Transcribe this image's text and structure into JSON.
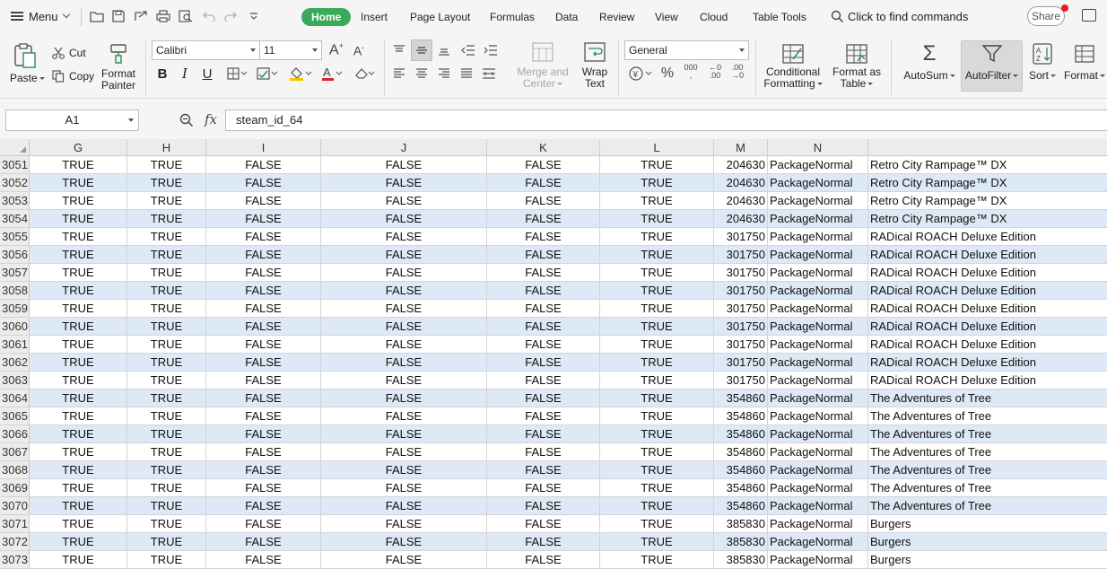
{
  "menubar": {
    "menu_label": "Menu",
    "tabs": [
      {
        "label": "Home",
        "active": true
      },
      {
        "label": "Insert"
      },
      {
        "label": "Page Layout"
      },
      {
        "label": "Formulas"
      },
      {
        "label": "Data"
      },
      {
        "label": "Review"
      },
      {
        "label": "View"
      },
      {
        "label": "Cloud"
      },
      {
        "label": "Table Tools"
      }
    ],
    "find_label": "Click to find commands",
    "share_label": "Share",
    "accent_color": "#3aaa5a"
  },
  "ribbon": {
    "paste": "Paste",
    "cut": "Cut",
    "copy": "Copy",
    "format_painter_1": "Format",
    "format_painter_2": "Painter",
    "font_name": "Calibri",
    "font_size": "11",
    "merge_1": "Merge and",
    "merge_2": "Center",
    "wrap_1": "Wrap",
    "wrap_2": "Text",
    "number_format": "General",
    "cond_1": "Conditional",
    "cond_2": "Formatting",
    "fmt_table_1": "Format as",
    "fmt_table_2": "Table",
    "autosum": "AutoSum",
    "autofilter": "AutoFilter",
    "sort": "Sort",
    "format": "Format"
  },
  "formula_bar": {
    "cell_ref": "A1",
    "fx_label": "fx",
    "formula": "steam_id_64"
  },
  "grid": {
    "columns": [
      "G",
      "H",
      "I",
      "J",
      "K",
      "L",
      "M",
      "N",
      ""
    ],
    "rows": [
      {
        "n": "3051",
        "cells": [
          "TRUE",
          "TRUE",
          "FALSE",
          "FALSE",
          "FALSE",
          "TRUE",
          "204630",
          "PackageNormal",
          "Retro City Rampage™ DX"
        ]
      },
      {
        "n": "3052",
        "cells": [
          "TRUE",
          "TRUE",
          "FALSE",
          "FALSE",
          "FALSE",
          "TRUE",
          "204630",
          "PackageNormal",
          "Retro City Rampage™ DX"
        ]
      },
      {
        "n": "3053",
        "cells": [
          "TRUE",
          "TRUE",
          "FALSE",
          "FALSE",
          "FALSE",
          "TRUE",
          "204630",
          "PackageNormal",
          "Retro City Rampage™ DX"
        ]
      },
      {
        "n": "3054",
        "cells": [
          "TRUE",
          "TRUE",
          "FALSE",
          "FALSE",
          "FALSE",
          "TRUE",
          "204630",
          "PackageNormal",
          "Retro City Rampage™ DX"
        ]
      },
      {
        "n": "3055",
        "cells": [
          "TRUE",
          "TRUE",
          "FALSE",
          "FALSE",
          "FALSE",
          "TRUE",
          "301750",
          "PackageNormal",
          "RADical ROACH Deluxe Edition"
        ]
      },
      {
        "n": "3056",
        "cells": [
          "TRUE",
          "TRUE",
          "FALSE",
          "FALSE",
          "FALSE",
          "TRUE",
          "301750",
          "PackageNormal",
          "RADical ROACH Deluxe Edition"
        ]
      },
      {
        "n": "3057",
        "cells": [
          "TRUE",
          "TRUE",
          "FALSE",
          "FALSE",
          "FALSE",
          "TRUE",
          "301750",
          "PackageNormal",
          "RADical ROACH Deluxe Edition"
        ]
      },
      {
        "n": "3058",
        "cells": [
          "TRUE",
          "TRUE",
          "FALSE",
          "FALSE",
          "FALSE",
          "TRUE",
          "301750",
          "PackageNormal",
          "RADical ROACH Deluxe Edition"
        ]
      },
      {
        "n": "3059",
        "cells": [
          "TRUE",
          "TRUE",
          "FALSE",
          "FALSE",
          "FALSE",
          "TRUE",
          "301750",
          "PackageNormal",
          "RADical ROACH Deluxe Edition"
        ]
      },
      {
        "n": "3060",
        "cells": [
          "TRUE",
          "TRUE",
          "FALSE",
          "FALSE",
          "FALSE",
          "TRUE",
          "301750",
          "PackageNormal",
          "RADical ROACH Deluxe Edition"
        ]
      },
      {
        "n": "3061",
        "cells": [
          "TRUE",
          "TRUE",
          "FALSE",
          "FALSE",
          "FALSE",
          "TRUE",
          "301750",
          "PackageNormal",
          "RADical ROACH Deluxe Edition"
        ]
      },
      {
        "n": "3062",
        "cells": [
          "TRUE",
          "TRUE",
          "FALSE",
          "FALSE",
          "FALSE",
          "TRUE",
          "301750",
          "PackageNormal",
          "RADical ROACH Deluxe Edition"
        ]
      },
      {
        "n": "3063",
        "cells": [
          "TRUE",
          "TRUE",
          "FALSE",
          "FALSE",
          "FALSE",
          "TRUE",
          "301750",
          "PackageNormal",
          "RADical ROACH Deluxe Edition"
        ]
      },
      {
        "n": "3064",
        "cells": [
          "TRUE",
          "TRUE",
          "FALSE",
          "FALSE",
          "FALSE",
          "TRUE",
          "354860",
          "PackageNormal",
          "The Adventures of Tree"
        ]
      },
      {
        "n": "3065",
        "cells": [
          "TRUE",
          "TRUE",
          "FALSE",
          "FALSE",
          "FALSE",
          "TRUE",
          "354860",
          "PackageNormal",
          "The Adventures of Tree"
        ]
      },
      {
        "n": "3066",
        "cells": [
          "TRUE",
          "TRUE",
          "FALSE",
          "FALSE",
          "FALSE",
          "TRUE",
          "354860",
          "PackageNormal",
          "The Adventures of Tree"
        ]
      },
      {
        "n": "3067",
        "cells": [
          "TRUE",
          "TRUE",
          "FALSE",
          "FALSE",
          "FALSE",
          "TRUE",
          "354860",
          "PackageNormal",
          "The Adventures of Tree"
        ]
      },
      {
        "n": "3068",
        "cells": [
          "TRUE",
          "TRUE",
          "FALSE",
          "FALSE",
          "FALSE",
          "TRUE",
          "354860",
          "PackageNormal",
          "The Adventures of Tree"
        ]
      },
      {
        "n": "3069",
        "cells": [
          "TRUE",
          "TRUE",
          "FALSE",
          "FALSE",
          "FALSE",
          "TRUE",
          "354860",
          "PackageNormal",
          "The Adventures of Tree"
        ]
      },
      {
        "n": "3070",
        "cells": [
          "TRUE",
          "TRUE",
          "FALSE",
          "FALSE",
          "FALSE",
          "TRUE",
          "354860",
          "PackageNormal",
          "The Adventures of Tree"
        ]
      },
      {
        "n": "3071",
        "cells": [
          "TRUE",
          "TRUE",
          "FALSE",
          "FALSE",
          "FALSE",
          "TRUE",
          "385830",
          "PackageNormal",
          "Burgers"
        ]
      },
      {
        "n": "3072",
        "cells": [
          "TRUE",
          "TRUE",
          "FALSE",
          "FALSE",
          "FALSE",
          "TRUE",
          "385830",
          "PackageNormal",
          "Burgers"
        ]
      },
      {
        "n": "3073",
        "cells": [
          "TRUE",
          "TRUE",
          "FALSE",
          "FALSE",
          "FALSE",
          "TRUE",
          "385830",
          "PackageNormal",
          "Burgers"
        ]
      }
    ],
    "band_color": "#dde9f6"
  }
}
